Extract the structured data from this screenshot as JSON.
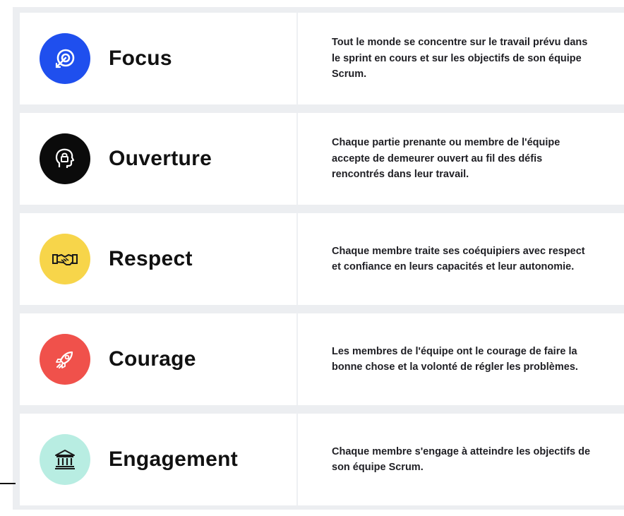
{
  "values": [
    {
      "title": "Focus",
      "description": "Tout le monde se concentre sur le travail prévu dans le sprint en cours et sur les objectifs de son équipe Scrum.",
      "icon": "target-arrow-icon",
      "color": "#1f4fee"
    },
    {
      "title": "Ouverture",
      "description": "Chaque partie prenante ou membre de l'équipe accepte de demeurer ouvert au fil des défis rencontrés dans leur travail.",
      "icon": "head-lock-icon",
      "color": "#0b0b0b"
    },
    {
      "title": "Respect",
      "description": "Chaque membre traite ses coéquipiers avec respect et confiance en leurs capacités et leur autonomie.",
      "icon": "handshake-icon",
      "color": "#f7d54a"
    },
    {
      "title": "Courage",
      "description": "Les membres de l'équipe ont le courage de faire la bonne chose et la volonté de régler les problèmes.",
      "icon": "rocket-icon",
      "color": "#f0514b"
    },
    {
      "title": "Engagement",
      "description": "Chaque membre s'engage à atteindre les objectifs de son équipe Scrum.",
      "icon": "institution-icon",
      "color": "#b8ede2"
    }
  ]
}
